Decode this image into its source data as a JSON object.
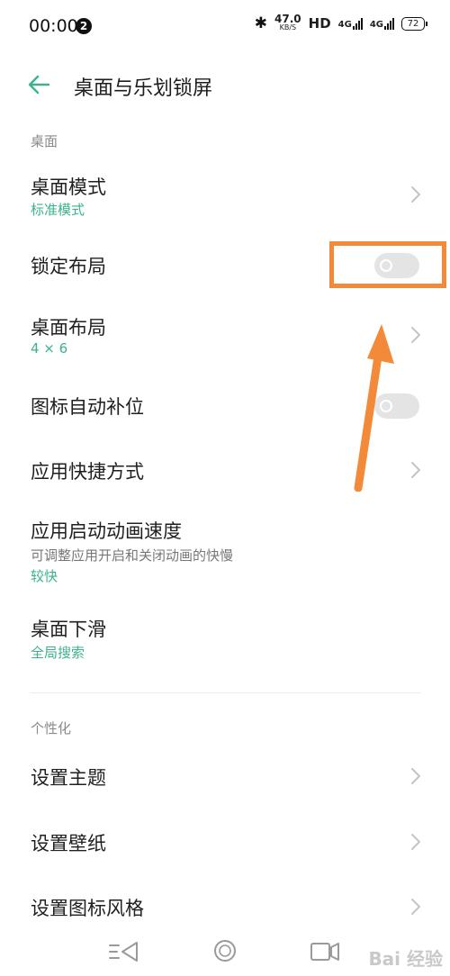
{
  "status_bar": {
    "time": "00:00",
    "notification_count": "2",
    "net_speed_value": "47.0",
    "net_speed_unit": "KB/S",
    "hd_label": "HD",
    "signal1": "4G",
    "signal2": "4G",
    "battery": "72"
  },
  "header": {
    "title": "桌面与乐划锁屏"
  },
  "sections": {
    "desktop": "桌面",
    "personalization": "个性化"
  },
  "rows": {
    "desktop_mode": {
      "title": "桌面模式",
      "value": "标准模式"
    },
    "lock_layout": {
      "title": "锁定布局",
      "enabled": false
    },
    "desktop_layout": {
      "title": "桌面布局",
      "value": "4 × 6"
    },
    "icon_autofill": {
      "title": "图标自动补位",
      "enabled": false
    },
    "app_shortcuts": {
      "title": "应用快捷方式"
    },
    "app_anim_speed": {
      "title": "应用启动动画速度",
      "desc": "可调整应用开启和关闭动画的快慢",
      "value": "较快"
    },
    "desktop_swipe": {
      "title": "桌面下滑",
      "value": "全局搜索"
    },
    "set_theme": {
      "title": "设置主题"
    },
    "set_wallpaper": {
      "title": "设置壁纸"
    },
    "set_icon_style": {
      "title": "设置图标风格"
    }
  },
  "watermark": "Bai 经验",
  "colors": {
    "accent": "#3cb38a",
    "annotation": "#f28a3a"
  }
}
